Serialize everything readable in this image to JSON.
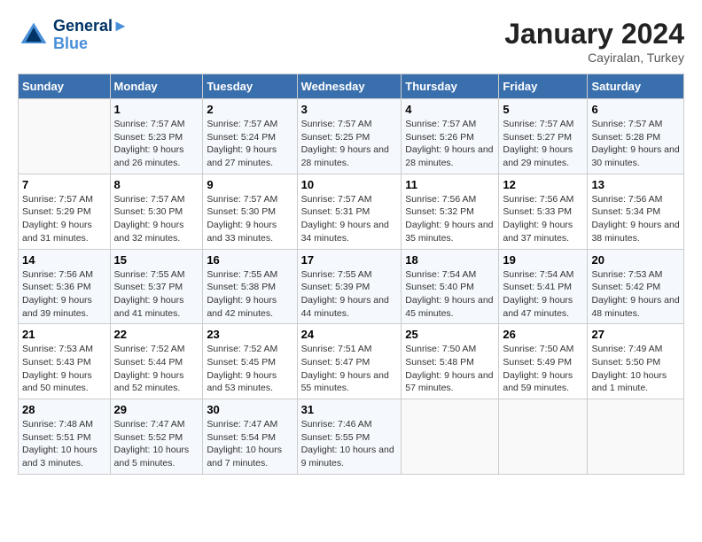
{
  "logo": {
    "line1": "General",
    "line2": "Blue"
  },
  "title": "January 2024",
  "subtitle": "Cayiralan, Turkey",
  "days_of_week": [
    "Sunday",
    "Monday",
    "Tuesday",
    "Wednesday",
    "Thursday",
    "Friday",
    "Saturday"
  ],
  "weeks": [
    [
      {
        "day": "",
        "info": ""
      },
      {
        "day": "1",
        "sunrise": "7:57 AM",
        "sunset": "5:23 PM",
        "daylight": "9 hours and 26 minutes."
      },
      {
        "day": "2",
        "sunrise": "7:57 AM",
        "sunset": "5:24 PM",
        "daylight": "9 hours and 27 minutes."
      },
      {
        "day": "3",
        "sunrise": "7:57 AM",
        "sunset": "5:25 PM",
        "daylight": "9 hours and 28 minutes."
      },
      {
        "day": "4",
        "sunrise": "7:57 AM",
        "sunset": "5:26 PM",
        "daylight": "9 hours and 28 minutes."
      },
      {
        "day": "5",
        "sunrise": "7:57 AM",
        "sunset": "5:27 PM",
        "daylight": "9 hours and 29 minutes."
      },
      {
        "day": "6",
        "sunrise": "7:57 AM",
        "sunset": "5:28 PM",
        "daylight": "9 hours and 30 minutes."
      }
    ],
    [
      {
        "day": "7",
        "sunrise": "7:57 AM",
        "sunset": "5:29 PM",
        "daylight": "9 hours and 31 minutes."
      },
      {
        "day": "8",
        "sunrise": "7:57 AM",
        "sunset": "5:30 PM",
        "daylight": "9 hours and 32 minutes."
      },
      {
        "day": "9",
        "sunrise": "7:57 AM",
        "sunset": "5:30 PM",
        "daylight": "9 hours and 33 minutes."
      },
      {
        "day": "10",
        "sunrise": "7:57 AM",
        "sunset": "5:31 PM",
        "daylight": "9 hours and 34 minutes."
      },
      {
        "day": "11",
        "sunrise": "7:56 AM",
        "sunset": "5:32 PM",
        "daylight": "9 hours and 35 minutes."
      },
      {
        "day": "12",
        "sunrise": "7:56 AM",
        "sunset": "5:33 PM",
        "daylight": "9 hours and 37 minutes."
      },
      {
        "day": "13",
        "sunrise": "7:56 AM",
        "sunset": "5:34 PM",
        "daylight": "9 hours and 38 minutes."
      }
    ],
    [
      {
        "day": "14",
        "sunrise": "7:56 AM",
        "sunset": "5:36 PM",
        "daylight": "9 hours and 39 minutes."
      },
      {
        "day": "15",
        "sunrise": "7:55 AM",
        "sunset": "5:37 PM",
        "daylight": "9 hours and 41 minutes."
      },
      {
        "day": "16",
        "sunrise": "7:55 AM",
        "sunset": "5:38 PM",
        "daylight": "9 hours and 42 minutes."
      },
      {
        "day": "17",
        "sunrise": "7:55 AM",
        "sunset": "5:39 PM",
        "daylight": "9 hours and 44 minutes."
      },
      {
        "day": "18",
        "sunrise": "7:54 AM",
        "sunset": "5:40 PM",
        "daylight": "9 hours and 45 minutes."
      },
      {
        "day": "19",
        "sunrise": "7:54 AM",
        "sunset": "5:41 PM",
        "daylight": "9 hours and 47 minutes."
      },
      {
        "day": "20",
        "sunrise": "7:53 AM",
        "sunset": "5:42 PM",
        "daylight": "9 hours and 48 minutes."
      }
    ],
    [
      {
        "day": "21",
        "sunrise": "7:53 AM",
        "sunset": "5:43 PM",
        "daylight": "9 hours and 50 minutes."
      },
      {
        "day": "22",
        "sunrise": "7:52 AM",
        "sunset": "5:44 PM",
        "daylight": "9 hours and 52 minutes."
      },
      {
        "day": "23",
        "sunrise": "7:52 AM",
        "sunset": "5:45 PM",
        "daylight": "9 hours and 53 minutes."
      },
      {
        "day": "24",
        "sunrise": "7:51 AM",
        "sunset": "5:47 PM",
        "daylight": "9 hours and 55 minutes."
      },
      {
        "day": "25",
        "sunrise": "7:50 AM",
        "sunset": "5:48 PM",
        "daylight": "9 hours and 57 minutes."
      },
      {
        "day": "26",
        "sunrise": "7:50 AM",
        "sunset": "5:49 PM",
        "daylight": "9 hours and 59 minutes."
      },
      {
        "day": "27",
        "sunrise": "7:49 AM",
        "sunset": "5:50 PM",
        "daylight": "10 hours and 1 minute."
      }
    ],
    [
      {
        "day": "28",
        "sunrise": "7:48 AM",
        "sunset": "5:51 PM",
        "daylight": "10 hours and 3 minutes."
      },
      {
        "day": "29",
        "sunrise": "7:47 AM",
        "sunset": "5:52 PM",
        "daylight": "10 hours and 5 minutes."
      },
      {
        "day": "30",
        "sunrise": "7:47 AM",
        "sunset": "5:54 PM",
        "daylight": "10 hours and 7 minutes."
      },
      {
        "day": "31",
        "sunrise": "7:46 AM",
        "sunset": "5:55 PM",
        "daylight": "10 hours and 9 minutes."
      },
      {
        "day": "",
        "info": ""
      },
      {
        "day": "",
        "info": ""
      },
      {
        "day": "",
        "info": ""
      }
    ]
  ]
}
